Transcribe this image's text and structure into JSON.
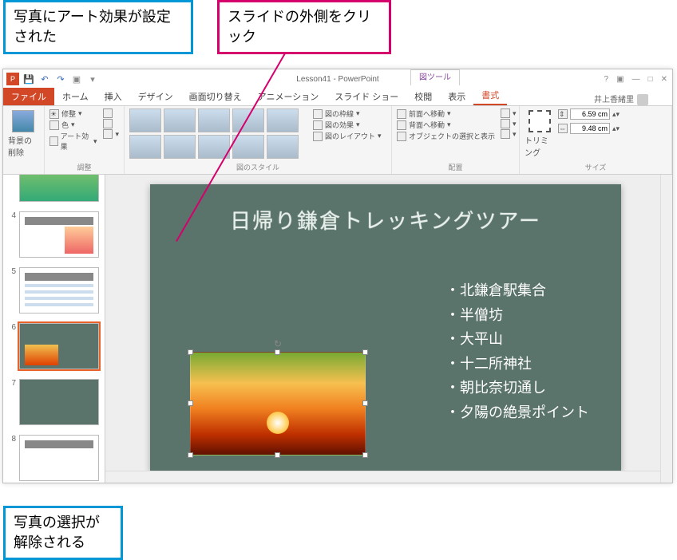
{
  "callouts": {
    "top_left": "写真にアート効果が設定された",
    "top_right": "スライドの外側をクリック",
    "bottom": "写真の選択が解除される"
  },
  "app": {
    "title": "Lesson41 - PowerPoint",
    "tool_tab": "図ツール",
    "username": "井上香緒里"
  },
  "tabs": {
    "file": "ファイル",
    "home": "ホーム",
    "insert": "挿入",
    "design": "デザイン",
    "transitions": "画面切り替え",
    "animations": "アニメーション",
    "slideshow": "スライド ショー",
    "review": "校閲",
    "view": "表示",
    "format": "書式"
  },
  "ribbon": {
    "remove_bg": "背景の削除",
    "corrections": "修整",
    "color": "色",
    "artistic": "アート効果",
    "adjust_label": "調整",
    "styles_label": "図のスタイル",
    "border": "図の枠線",
    "effects": "図の効果",
    "layout": "図のレイアウト",
    "bring_fwd": "前面へ移動",
    "send_back": "背面へ移動",
    "selection": "オブジェクトの選択と表示",
    "arrange_label": "配置",
    "crop": "トリミング",
    "height": "6.59 cm",
    "width": "9.48 cm",
    "size_label": "サイズ"
  },
  "thumbs": {
    "n4": "4",
    "n5": "5",
    "n6": "6",
    "n7": "7",
    "n8": "8"
  },
  "slide": {
    "title": "日帰り鎌倉トレッキングツアー",
    "bullets": [
      "北鎌倉駅集合",
      "半僧坊",
      "大平山",
      "十二所神社",
      "朝比奈切通し",
      "夕陽の絶景ポイント"
    ]
  }
}
